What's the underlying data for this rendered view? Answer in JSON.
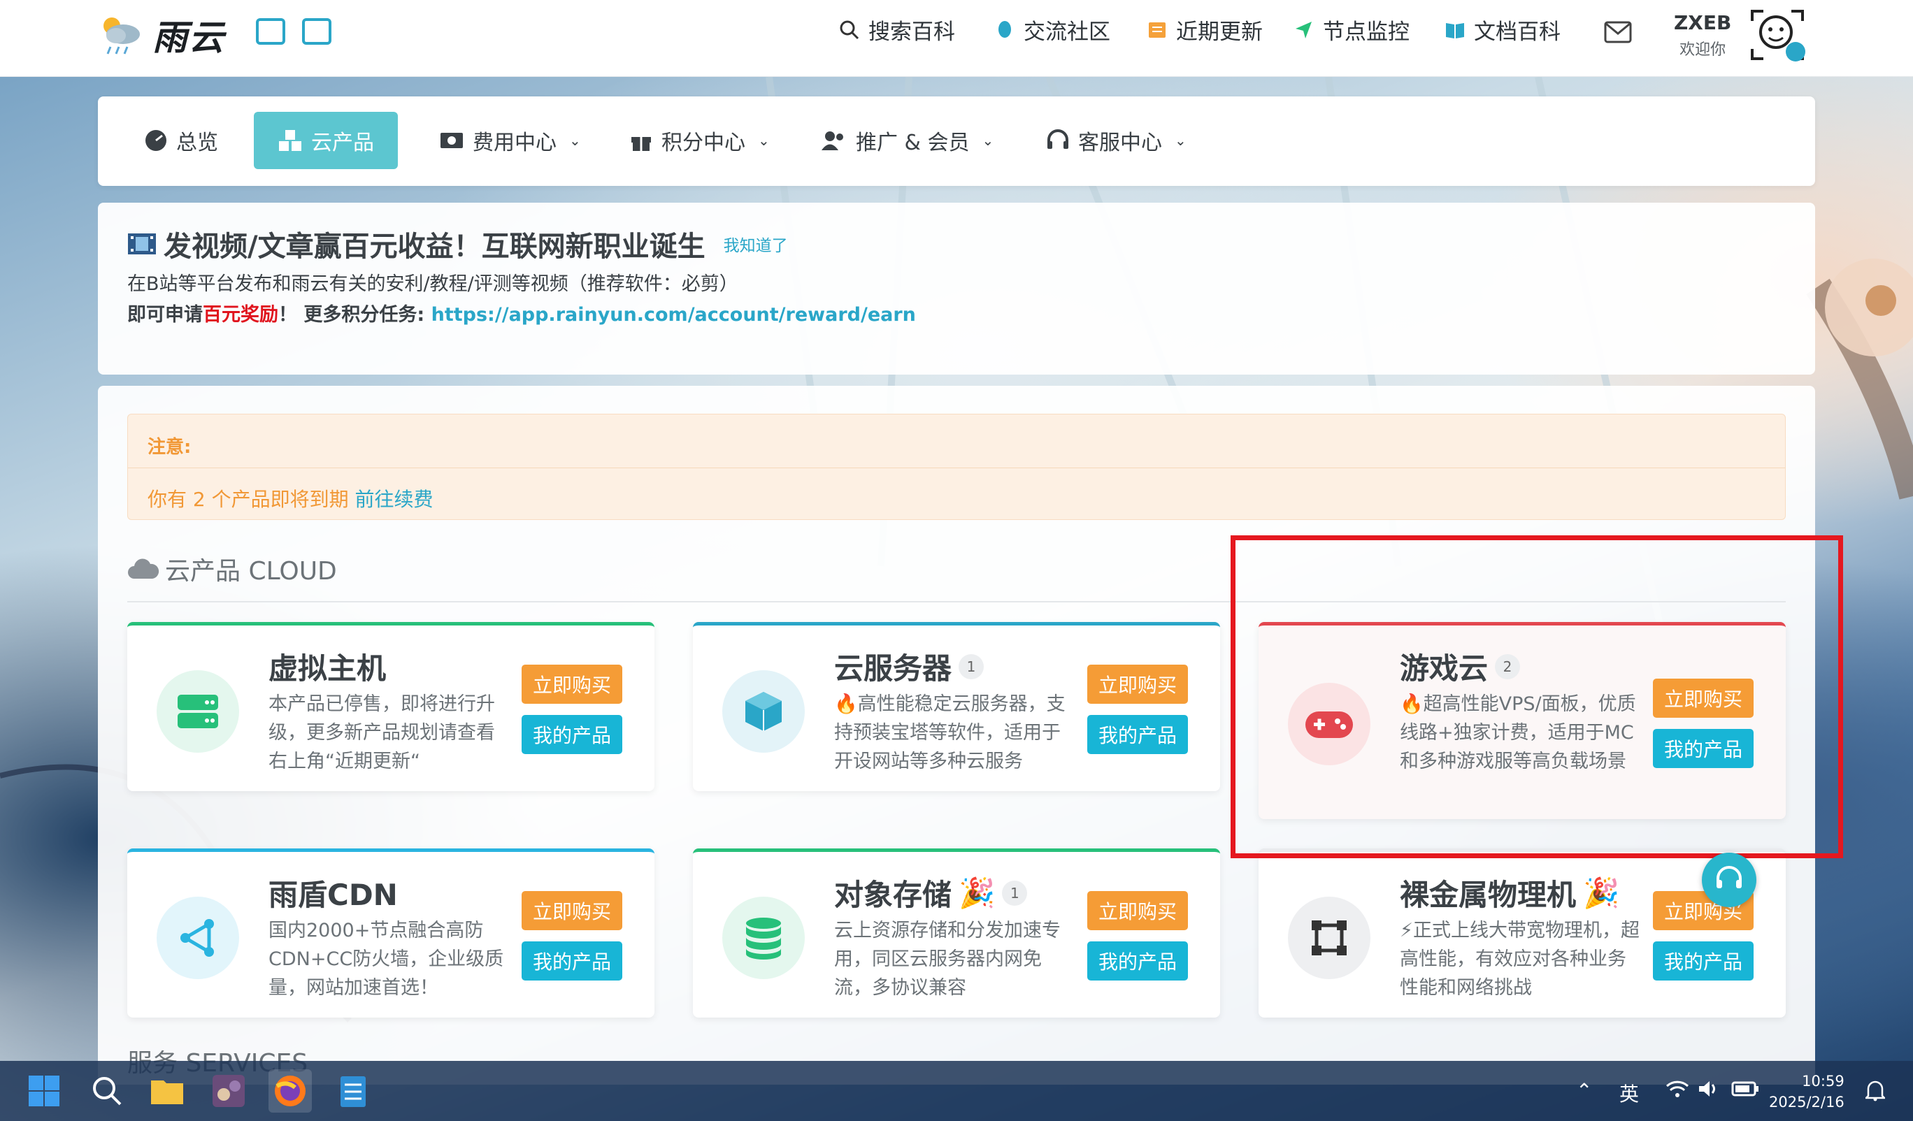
{
  "app": {
    "logo_text": "雨云"
  },
  "topnav": {
    "items": [
      {
        "label": "搜索百科"
      },
      {
        "label": "交流社区"
      },
      {
        "label": "近期更新"
      },
      {
        "label": "节点监控"
      },
      {
        "label": "文档百科"
      }
    ],
    "user": {
      "name": "ZXEB",
      "welcome": "欢迎你"
    }
  },
  "menu": {
    "items": [
      {
        "label": "总览"
      },
      {
        "label": "云产品"
      },
      {
        "label": "费用中心"
      },
      {
        "label": "积分中心"
      },
      {
        "label": "推广 & 会员"
      },
      {
        "label": "客服中心"
      }
    ]
  },
  "notice": {
    "title": "发视频/文章赢百元收益！互联网新职业诞生",
    "dismiss": "我知道了",
    "line1": "在B站等平台发布和雨云有关的安利/教程/评测等视频（推荐软件：必剪）",
    "line2_prefix": "即可申请",
    "line2_red": "百元奖励",
    "line2_mid": "！ 更多积分任务: ",
    "line2_link": "https://app.rainyun.com/account/reward/earn"
  },
  "alert": {
    "title": "注意:",
    "message": "你有 2 个产品即将到期",
    "link": "前往续费"
  },
  "section": {
    "title": "云产品 CLOUD",
    "next_title": "服务 SERVICES"
  },
  "buttons": {
    "buy": "立即购买",
    "mine": "我的产品"
  },
  "cards": [
    {
      "title": "虚拟主机",
      "badge": "",
      "desc": "本产品已停售，即将进行升级，更多新产品规划请查看右上角“近期更新“",
      "color": "#27c07a",
      "icon": "server-icon"
    },
    {
      "title": "云服务器",
      "badge": "1",
      "desc": "🔥高性能稳定云服务器，支持预装宝塔等软件，适用于开设网站等多种云服务",
      "color": "#2aa6c8",
      "icon": "cube-icon"
    },
    {
      "title": "游戏云",
      "badge": "2",
      "desc": "🔥超高性能VPS/面板，优质线路+独家计费，适用于MC和多种游戏服等高负载场景",
      "color": "#e3474f",
      "icon": "gamepad-icon"
    },
    {
      "title": "雨盾CDN",
      "badge": "",
      "desc": "国内2000+节点融合高防CDN+CC防火墙，企业级质量，网站加速首选！",
      "color": "#2ab4e0",
      "icon": "share-icon"
    },
    {
      "title": "对象存储",
      "badge": "1",
      "desc": "云上资源存储和分发加速专用，同区云服务器内网免流，多协议兼容",
      "color": "#27c07a",
      "icon": "database-icon"
    },
    {
      "title": "裸金属物理机",
      "badge": "",
      "desc": "⚡正式上线大带宽物理机，超高性能，有效应对各种业务性能和网络挑战",
      "color": "#e5e7ea",
      "icon": "frame-icon"
    }
  ],
  "taskbar": {
    "ime": "英",
    "time": "10:59",
    "date": "2025/2/16"
  }
}
